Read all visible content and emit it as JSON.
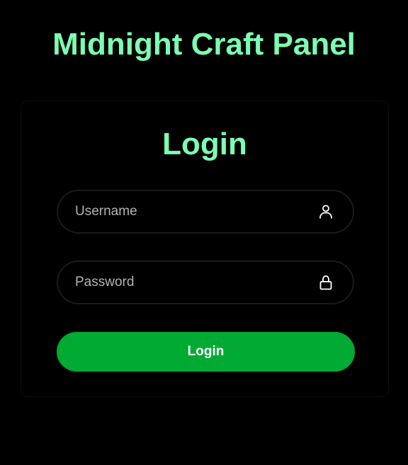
{
  "header": {
    "title": "Midnight Craft Panel"
  },
  "login_card": {
    "title": "Login",
    "username": {
      "value": "",
      "placeholder": "Username",
      "icon": "user-icon"
    },
    "password": {
      "value": "",
      "placeholder": "Password",
      "icon": "lock-icon"
    },
    "submit_label": "Login"
  },
  "colors": {
    "background": "#000000",
    "accent_text": "#7CFFB2",
    "button": "#00AA33",
    "button_text": "#FFFFFF",
    "placeholder": "#B3B3B3"
  }
}
